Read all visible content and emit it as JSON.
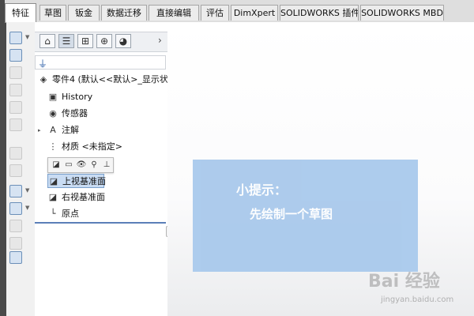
{
  "tabs": [
    "特征",
    "草图",
    "钣金",
    "数据迁移",
    "直接编辑",
    "评估",
    "DimXpert",
    "SOLIDWORKS 插件",
    "SOLIDWORKS MBD"
  ],
  "active_tab_index": 0,
  "feature_tree": {
    "root": "零件4 (默认<<默认>_显示状态",
    "items": [
      {
        "label": "History",
        "icon": "history-icon"
      },
      {
        "label": "传感器",
        "icon": "sensor-icon"
      },
      {
        "label": "注解",
        "icon": "annotation-icon"
      },
      {
        "label": "材质 <未指定>",
        "icon": "material-icon"
      },
      {
        "label": "上视基准面",
        "icon": "plane-icon",
        "selected": true
      },
      {
        "label": "右视基准面",
        "icon": "plane-icon"
      },
      {
        "label": "原点",
        "icon": "origin-icon"
      }
    ]
  },
  "tip": {
    "title": "小提示：",
    "text": "先绘制一个草图"
  },
  "watermark": {
    "main": "Bai 经验",
    "sub": "jingyan.baidu.com"
  }
}
